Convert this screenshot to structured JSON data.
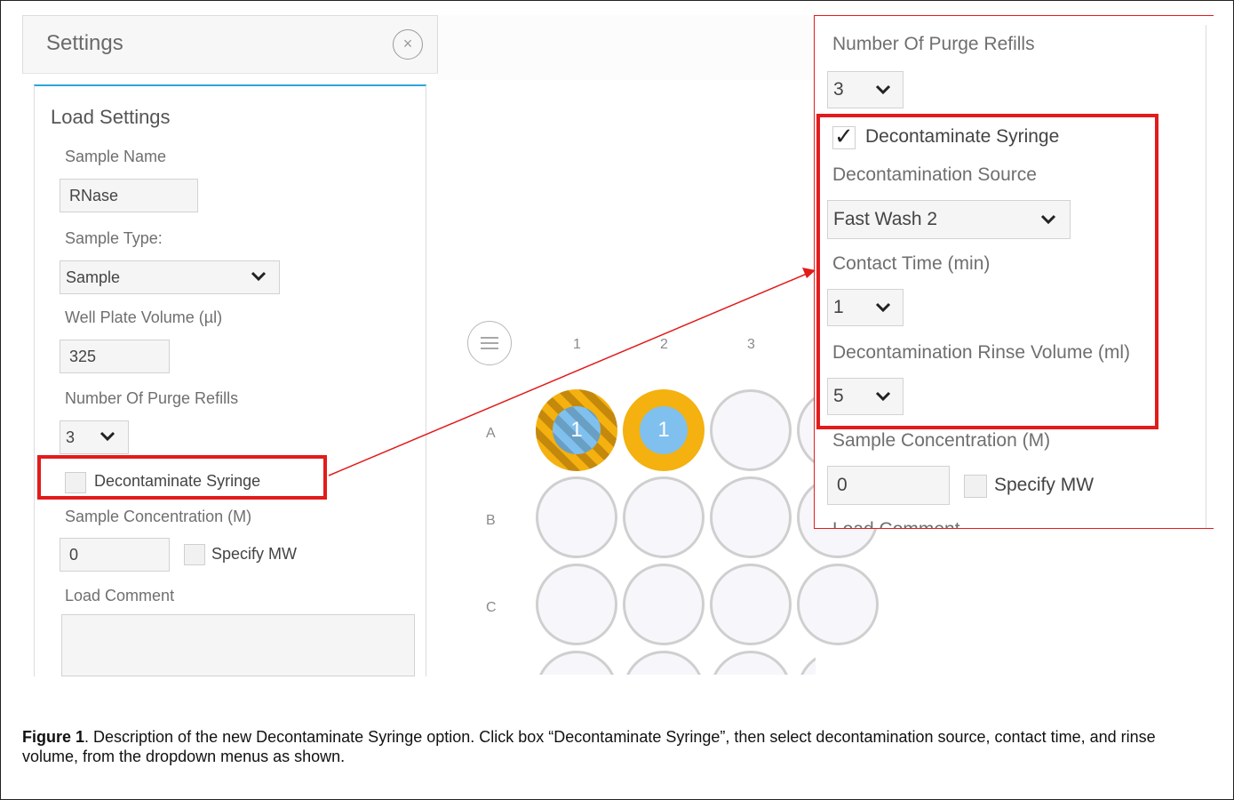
{
  "settings": {
    "title": "Settings",
    "close_glyph": "×",
    "section_title": "Load Settings",
    "sample_name_label": "Sample Name",
    "sample_name_value": "RNase",
    "sample_type_label": "Sample Type:",
    "sample_type_value": "Sample",
    "well_plate_volume_label": "Well Plate Volume (µl)",
    "well_plate_volume_value": "325",
    "purge_refills_label": "Number Of Purge Refills",
    "purge_refills_value": "3",
    "decontaminate_label": "Decontaminate Syringe",
    "decontaminate_checked": false,
    "sample_conc_label": "Sample Concentration (M)",
    "sample_conc_value": "0",
    "specify_mw_label": "Specify MW",
    "load_comment_label": "Load Comment",
    "load_comment_value": ""
  },
  "plate": {
    "columns": [
      "1",
      "2",
      "3"
    ],
    "rows": [
      "A",
      "B",
      "C"
    ],
    "well_labels": {
      "A1": "1",
      "A2": "1"
    }
  },
  "zoom": {
    "purge_refills_label": "Number Of Purge Refills",
    "purge_refills_value": "3",
    "decontaminate_check_glyph": "✓",
    "decontaminate_label": "Decontaminate Syringe",
    "decontaminate_checked": true,
    "source_label": "Decontamination Source",
    "source_value": "Fast Wash 2",
    "contact_time_label": "Contact Time (min)",
    "contact_time_value": "1",
    "rinse_volume_label": "Decontamination Rinse Volume (ml)",
    "rinse_volume_value": "5",
    "sample_conc_label": "Sample Concentration (M)",
    "sample_conc_value": "0",
    "specify_mw_label": "Specify MW",
    "load_comment_label": "Load Comment"
  },
  "caption": {
    "figure_label": "Figure 1",
    "text": ". Description of the new Decontaminate Syringe option. Click box “Decontaminate Syringe”, then select decontamination source, contact time, and rinse volume, from the dropdown menus as shown."
  },
  "colors": {
    "highlight_red": "#e21b1b",
    "accent_blue": "#2aa6dd",
    "well_gold": "#f4b10f",
    "well_blue": "#7fc0ee"
  }
}
